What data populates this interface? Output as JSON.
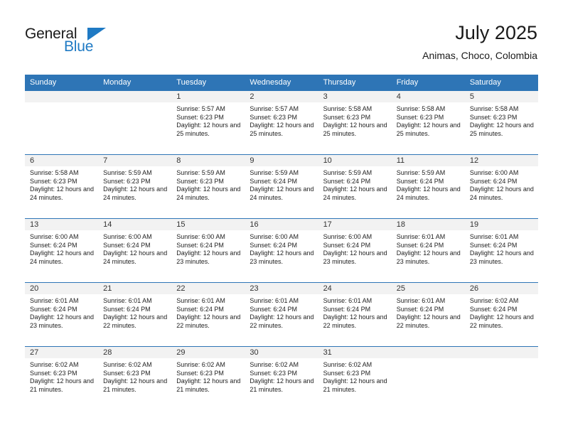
{
  "brand": {
    "name_top": "General",
    "name_bottom": "Blue",
    "accent_color": "#1f7ac4"
  },
  "header": {
    "title": "July 2025",
    "subtitle": "Animas, Choco, Colombia"
  },
  "theme": {
    "header_row_bg": "#2e75b6",
    "daynum_bg": "#f2f2f2",
    "text": "#222222"
  },
  "weekday_headers": [
    "Sunday",
    "Monday",
    "Tuesday",
    "Wednesday",
    "Thursday",
    "Friday",
    "Saturday"
  ],
  "weeks": [
    [
      {
        "day": "",
        "sunrise": "",
        "sunset": "",
        "daylight": "",
        "empty": true
      },
      {
        "day": "",
        "sunrise": "",
        "sunset": "",
        "daylight": "",
        "empty": true
      },
      {
        "day": "1",
        "sunrise": "Sunrise: 5:57 AM",
        "sunset": "Sunset: 6:23 PM",
        "daylight": "Daylight: 12 hours and 25 minutes."
      },
      {
        "day": "2",
        "sunrise": "Sunrise: 5:57 AM",
        "sunset": "Sunset: 6:23 PM",
        "daylight": "Daylight: 12 hours and 25 minutes."
      },
      {
        "day": "3",
        "sunrise": "Sunrise: 5:58 AM",
        "sunset": "Sunset: 6:23 PM",
        "daylight": "Daylight: 12 hours and 25 minutes."
      },
      {
        "day": "4",
        "sunrise": "Sunrise: 5:58 AM",
        "sunset": "Sunset: 6:23 PM",
        "daylight": "Daylight: 12 hours and 25 minutes."
      },
      {
        "day": "5",
        "sunrise": "Sunrise: 5:58 AM",
        "sunset": "Sunset: 6:23 PM",
        "daylight": "Daylight: 12 hours and 25 minutes."
      }
    ],
    [
      {
        "day": "6",
        "sunrise": "Sunrise: 5:58 AM",
        "sunset": "Sunset: 6:23 PM",
        "daylight": "Daylight: 12 hours and 24 minutes."
      },
      {
        "day": "7",
        "sunrise": "Sunrise: 5:59 AM",
        "sunset": "Sunset: 6:23 PM",
        "daylight": "Daylight: 12 hours and 24 minutes."
      },
      {
        "day": "8",
        "sunrise": "Sunrise: 5:59 AM",
        "sunset": "Sunset: 6:23 PM",
        "daylight": "Daylight: 12 hours and 24 minutes."
      },
      {
        "day": "9",
        "sunrise": "Sunrise: 5:59 AM",
        "sunset": "Sunset: 6:24 PM",
        "daylight": "Daylight: 12 hours and 24 minutes."
      },
      {
        "day": "10",
        "sunrise": "Sunrise: 5:59 AM",
        "sunset": "Sunset: 6:24 PM",
        "daylight": "Daylight: 12 hours and 24 minutes."
      },
      {
        "day": "11",
        "sunrise": "Sunrise: 5:59 AM",
        "sunset": "Sunset: 6:24 PM",
        "daylight": "Daylight: 12 hours and 24 minutes."
      },
      {
        "day": "12",
        "sunrise": "Sunrise: 6:00 AM",
        "sunset": "Sunset: 6:24 PM",
        "daylight": "Daylight: 12 hours and 24 minutes."
      }
    ],
    [
      {
        "day": "13",
        "sunrise": "Sunrise: 6:00 AM",
        "sunset": "Sunset: 6:24 PM",
        "daylight": "Daylight: 12 hours and 24 minutes."
      },
      {
        "day": "14",
        "sunrise": "Sunrise: 6:00 AM",
        "sunset": "Sunset: 6:24 PM",
        "daylight": "Daylight: 12 hours and 24 minutes."
      },
      {
        "day": "15",
        "sunrise": "Sunrise: 6:00 AM",
        "sunset": "Sunset: 6:24 PM",
        "daylight": "Daylight: 12 hours and 23 minutes."
      },
      {
        "day": "16",
        "sunrise": "Sunrise: 6:00 AM",
        "sunset": "Sunset: 6:24 PM",
        "daylight": "Daylight: 12 hours and 23 minutes."
      },
      {
        "day": "17",
        "sunrise": "Sunrise: 6:00 AM",
        "sunset": "Sunset: 6:24 PM",
        "daylight": "Daylight: 12 hours and 23 minutes."
      },
      {
        "day": "18",
        "sunrise": "Sunrise: 6:01 AM",
        "sunset": "Sunset: 6:24 PM",
        "daylight": "Daylight: 12 hours and 23 minutes."
      },
      {
        "day": "19",
        "sunrise": "Sunrise: 6:01 AM",
        "sunset": "Sunset: 6:24 PM",
        "daylight": "Daylight: 12 hours and 23 minutes."
      }
    ],
    [
      {
        "day": "20",
        "sunrise": "Sunrise: 6:01 AM",
        "sunset": "Sunset: 6:24 PM",
        "daylight": "Daylight: 12 hours and 23 minutes."
      },
      {
        "day": "21",
        "sunrise": "Sunrise: 6:01 AM",
        "sunset": "Sunset: 6:24 PM",
        "daylight": "Daylight: 12 hours and 22 minutes."
      },
      {
        "day": "22",
        "sunrise": "Sunrise: 6:01 AM",
        "sunset": "Sunset: 6:24 PM",
        "daylight": "Daylight: 12 hours and 22 minutes."
      },
      {
        "day": "23",
        "sunrise": "Sunrise: 6:01 AM",
        "sunset": "Sunset: 6:24 PM",
        "daylight": "Daylight: 12 hours and 22 minutes."
      },
      {
        "day": "24",
        "sunrise": "Sunrise: 6:01 AM",
        "sunset": "Sunset: 6:24 PM",
        "daylight": "Daylight: 12 hours and 22 minutes."
      },
      {
        "day": "25",
        "sunrise": "Sunrise: 6:01 AM",
        "sunset": "Sunset: 6:24 PM",
        "daylight": "Daylight: 12 hours and 22 minutes."
      },
      {
        "day": "26",
        "sunrise": "Sunrise: 6:02 AM",
        "sunset": "Sunset: 6:24 PM",
        "daylight": "Daylight: 12 hours and 22 minutes."
      }
    ],
    [
      {
        "day": "27",
        "sunrise": "Sunrise: 6:02 AM",
        "sunset": "Sunset: 6:23 PM",
        "daylight": "Daylight: 12 hours and 21 minutes."
      },
      {
        "day": "28",
        "sunrise": "Sunrise: 6:02 AM",
        "sunset": "Sunset: 6:23 PM",
        "daylight": "Daylight: 12 hours and 21 minutes."
      },
      {
        "day": "29",
        "sunrise": "Sunrise: 6:02 AM",
        "sunset": "Sunset: 6:23 PM",
        "daylight": "Daylight: 12 hours and 21 minutes."
      },
      {
        "day": "30",
        "sunrise": "Sunrise: 6:02 AM",
        "sunset": "Sunset: 6:23 PM",
        "daylight": "Daylight: 12 hours and 21 minutes."
      },
      {
        "day": "31",
        "sunrise": "Sunrise: 6:02 AM",
        "sunset": "Sunset: 6:23 PM",
        "daylight": "Daylight: 12 hours and 21 minutes."
      },
      {
        "day": "",
        "sunrise": "",
        "sunset": "",
        "daylight": "",
        "empty": true
      },
      {
        "day": "",
        "sunrise": "",
        "sunset": "",
        "daylight": "",
        "empty": true
      }
    ]
  ]
}
